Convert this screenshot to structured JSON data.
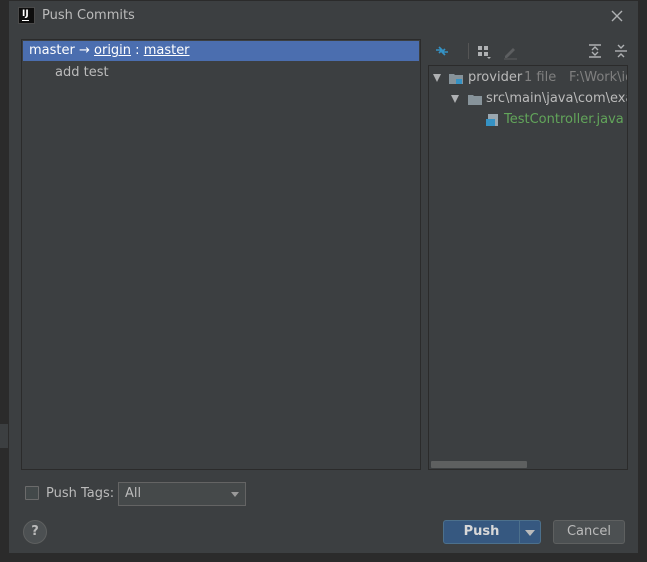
{
  "window": {
    "title": "Push Commits"
  },
  "commits": {
    "branch": "master",
    "arrow": " → ",
    "remote": "origin",
    "colon": " : ",
    "target_branch": "master",
    "message": "add test"
  },
  "toolbar": {
    "icons": [
      "show-diff-icon",
      "group-by-icon",
      "edit-source-icon",
      "expand-all-icon",
      "collapse-all-icon"
    ]
  },
  "tree": {
    "root": {
      "name": "provider",
      "count": "1 file",
      "path": "F:\\Work\\ide"
    },
    "folder": {
      "name": "src\\main\\java\\com\\exam"
    },
    "file": {
      "name": "TestController.java"
    }
  },
  "options": {
    "push_tags_label": "Push Tags:",
    "push_tags_value": "All",
    "push_tags_checked": false
  },
  "buttons": {
    "help": "?",
    "push": "Push",
    "cancel": "Cancel"
  },
  "colors": {
    "dialog_bg": "#3c3f41",
    "selection": "#4b6eaf",
    "primary_button": "#365880",
    "file_added": "#62a55a",
    "icon_blue": "#3592c4"
  }
}
